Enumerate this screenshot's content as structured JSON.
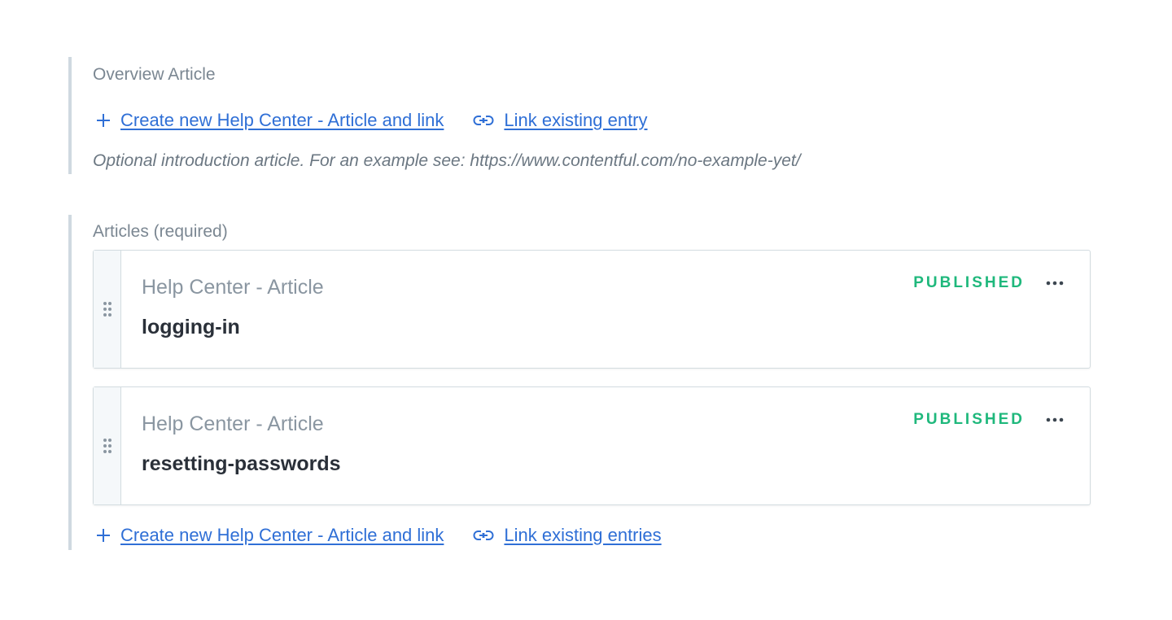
{
  "overview": {
    "label": "Overview Article",
    "create_link": "Create new Help Center - Article and link",
    "link_existing": "Link existing entry",
    "help_text": "Optional introduction article. For an example see: https://www.contentful.com/no-example-yet/"
  },
  "articles": {
    "label": "Articles (required)",
    "entries": [
      {
        "content_type": "Help Center - Article",
        "title": "logging-in",
        "status": "PUBLISHED"
      },
      {
        "content_type": "Help Center - Article",
        "title": "resetting-passwords",
        "status": "PUBLISHED"
      }
    ],
    "create_link": "Create new Help Center - Article and link",
    "link_existing": "Link existing entries"
  },
  "icons": {
    "add": "plus-icon",
    "link": "link-icon",
    "drag": "drag-handle-icon",
    "menu": "more-horizontal-icon"
  },
  "colors": {
    "link": "#2f6fd6",
    "published": "#1fb87c",
    "field_border": "#cfd9e0",
    "label": "#7b8792"
  }
}
